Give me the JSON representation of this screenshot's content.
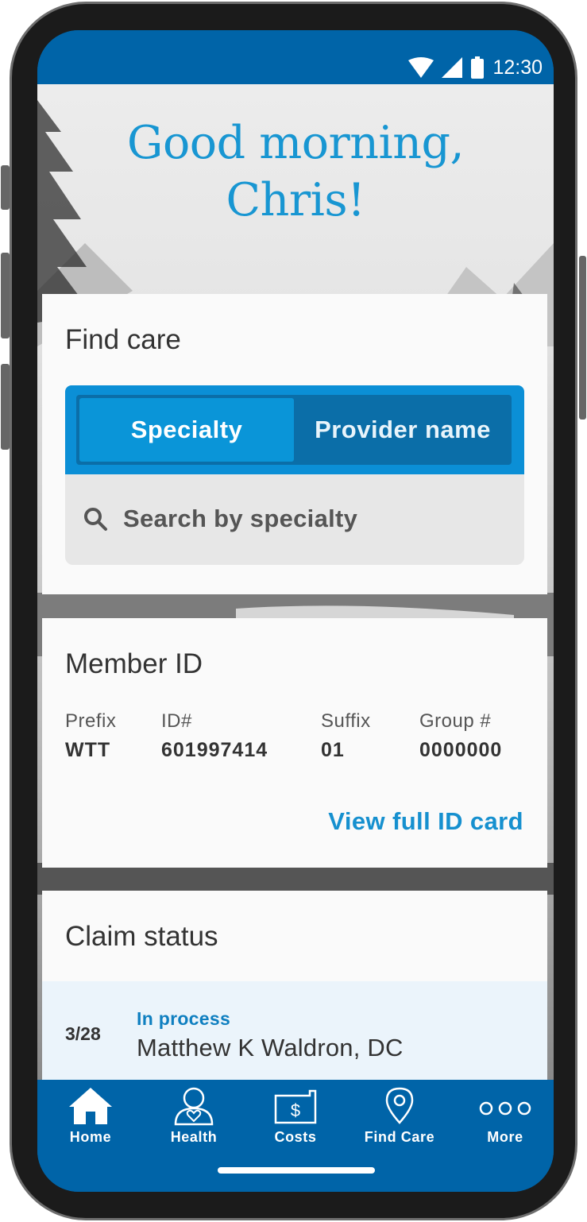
{
  "status_bar": {
    "time": "12:30",
    "icons": [
      "wifi-icon",
      "signal-icon",
      "battery-icon"
    ]
  },
  "greeting": {
    "line1": "Good morning,",
    "line2": "Chris!"
  },
  "find_care": {
    "title": "Find care",
    "tabs": [
      {
        "label": "Specialty",
        "selected": true
      },
      {
        "label": "Provider name",
        "selected": false
      }
    ],
    "search": {
      "placeholder": "Search by specialty",
      "icon": "search-icon"
    }
  },
  "member_id": {
    "title": "Member ID",
    "columns": [
      {
        "label": "Prefix",
        "value": "WTT"
      },
      {
        "label": "ID#",
        "value": "601997414"
      },
      {
        "label": "Suffix",
        "value": "01"
      },
      {
        "label": "Group #",
        "value": "0000000"
      }
    ],
    "link": "View full ID card"
  },
  "claim_status": {
    "title": "Claim status",
    "claims": [
      {
        "date": "3/28",
        "status": "In process",
        "provider": "Matthew K Waldron, DC"
      }
    ]
  },
  "bottom_nav": {
    "items": [
      {
        "label": "Home",
        "icon": "home-icon"
      },
      {
        "label": "Health",
        "icon": "health-icon"
      },
      {
        "label": "Costs",
        "icon": "costs-icon"
      },
      {
        "label": "Find Care",
        "icon": "location-pin-icon"
      },
      {
        "label": "More",
        "icon": "more-icon"
      }
    ]
  },
  "colors": {
    "brand_blue": "#0064a8",
    "accent_blue": "#0b8fd6",
    "link_blue": "#1690cf",
    "greeting_blue": "#1896d2"
  }
}
